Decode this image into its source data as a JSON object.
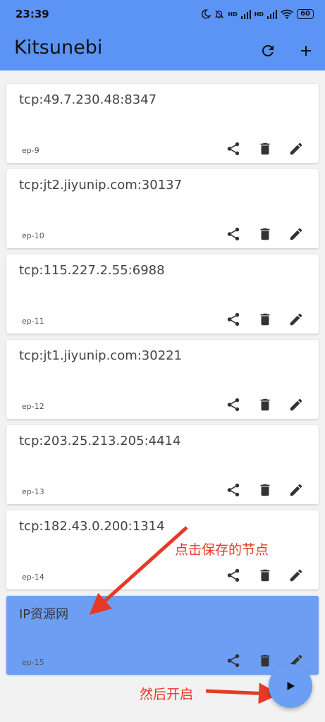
{
  "status_bar": {
    "time": "23:39",
    "signal_1": "HD",
    "signal_2": "HD",
    "battery": "60"
  },
  "app_bar": {
    "title": "Kitsunebi",
    "refresh_icon": "refresh-icon",
    "add_icon": "add-icon"
  },
  "endpoints": [
    {
      "address": "tcp:49.7.230.48:8347",
      "tag": "ep-9",
      "selected": false
    },
    {
      "address": "tcp:jt2.jiyunip.com:30137",
      "tag": "ep-10",
      "selected": false
    },
    {
      "address": "tcp:115.227.2.55:6988",
      "tag": "ep-11",
      "selected": false
    },
    {
      "address": "tcp:jt1.jiyunip.com:30221",
      "tag": "ep-12",
      "selected": false
    },
    {
      "address": "tcp:203.25.213.205:4414",
      "tag": "ep-13",
      "selected": false
    },
    {
      "address": "tcp:182.43.0.200:1314",
      "tag": "ep-14",
      "selected": false
    },
    {
      "address": "IP资源网",
      "tag": "ep-15",
      "selected": true
    }
  ],
  "annotations": {
    "click_saved_node": "点击保存的节点",
    "then_start": "然后开启"
  },
  "colors": {
    "accent": "#5b94f5",
    "selected": "#6c9ef4",
    "annotation": "#e53a26"
  }
}
